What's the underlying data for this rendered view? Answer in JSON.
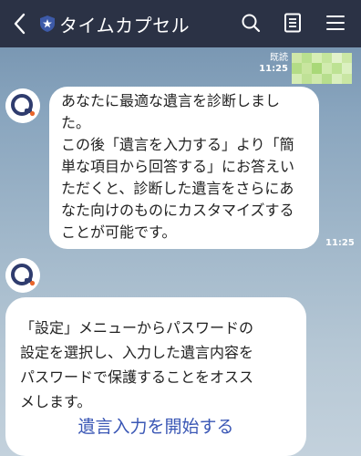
{
  "header": {
    "title": "タイムカプセル"
  },
  "messages": [
    {
      "text_lines": [
        "あなたに最適な遺言を診断しまし",
        "た。",
        "この後「遺言を入力する」より「簡",
        "単な項目から回答する」にお答えい",
        "ただくと、診断した遺言をさらにあ",
        "なた向けのものにカスタマイズする",
        "ことが可能です。"
      ],
      "time": "11:25"
    },
    {
      "text_lines": [
        "「設定」メニューからパスワードの",
        "設定を選択し、入力した遺言内容を",
        "パスワードで保護することをオスス",
        "メします。"
      ],
      "action_label": "遺言入力を開始する"
    }
  ],
  "sent": {
    "read_label": "既読",
    "time": "11:25"
  },
  "colors": {
    "header_bg": "#2b3245",
    "link": "#3a57b5",
    "brand_navy": "#2f3c6e",
    "brand_orange": "#e8662c"
  }
}
